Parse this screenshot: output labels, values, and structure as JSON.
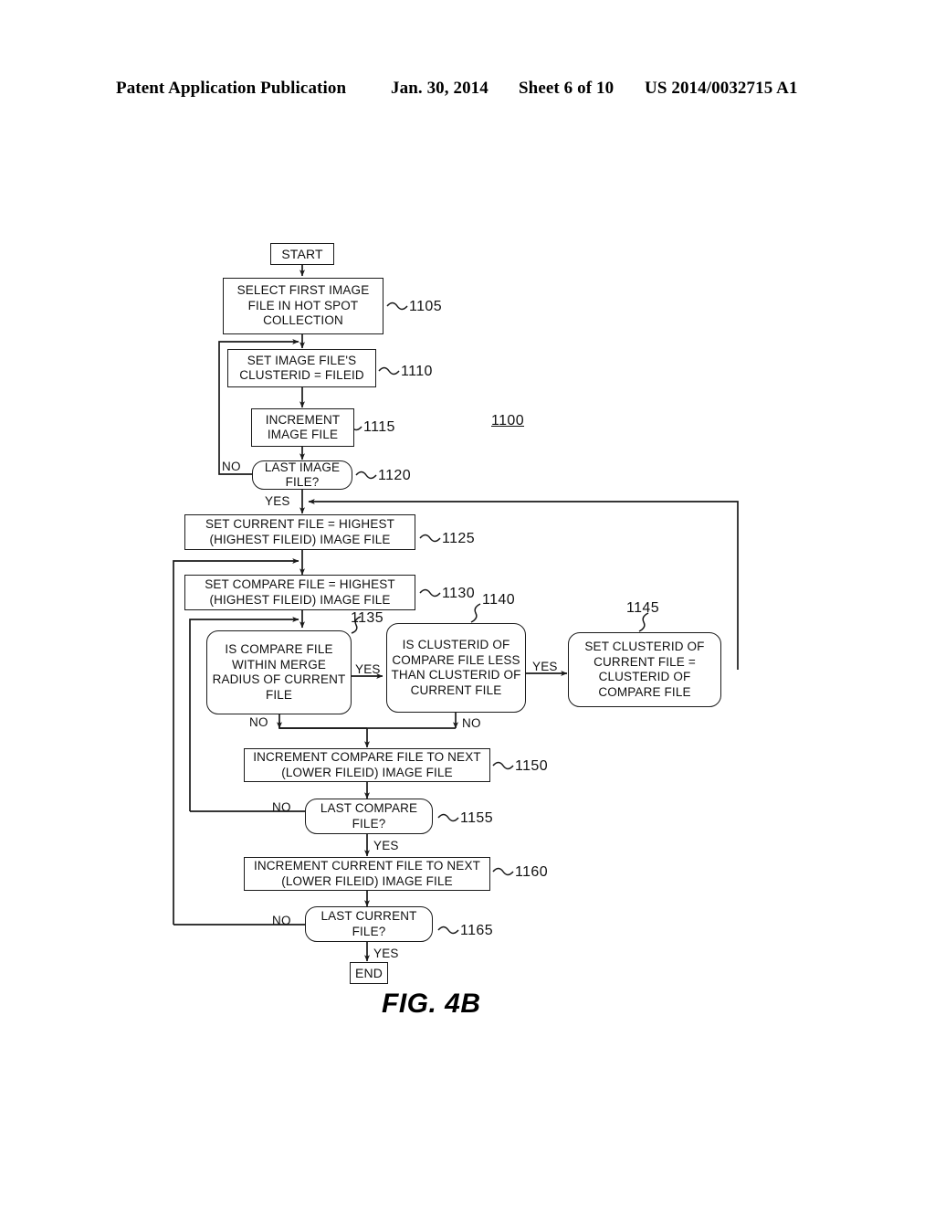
{
  "header": {
    "publication": "Patent Application Publication",
    "date": "Jan. 30, 2014",
    "sheet": "Sheet 6 of 10",
    "number": "US 2014/0032715 A1"
  },
  "figure": {
    "caption": "FIG. 4B",
    "diagram_ref": "1100"
  },
  "nodes": {
    "start": {
      "label": "START",
      "ref": ""
    },
    "select_first": {
      "label": "SELECT FIRST IMAGE FILE IN HOT SPOT COLLECTION",
      "ref": "1105"
    },
    "set_clusterid": {
      "label": "SET IMAGE FILE'S CLUSTERID = FILEID",
      "ref": "1110"
    },
    "increment_image": {
      "label": "INCREMENT IMAGE FILE",
      "ref": "1115"
    },
    "last_image": {
      "label": "LAST IMAGE FILE?",
      "ref": "1120"
    },
    "set_current": {
      "label": "SET CURRENT FILE = HIGHEST (HIGHEST FILEID) IMAGE FILE",
      "ref": "1125"
    },
    "set_compare": {
      "label": "SET COMPARE FILE = HIGHEST (HIGHEST FILEID) IMAGE FILE",
      "ref": "1130"
    },
    "within_radius": {
      "label": "IS COMPARE FILE WITHIN MERGE RADIUS OF CURRENT FILE",
      "ref": "1135"
    },
    "clusterid_less": {
      "label": "IS CLUSTERID OF COMPARE FILE LESS THAN CLUSTERID OF CURRENT FILE",
      "ref": "1140"
    },
    "set_cluster_merge": {
      "label": "SET CLUSTERID OF CURRENT FILE = CLUSTERID OF COMPARE FILE",
      "ref": "1145"
    },
    "increment_compare": {
      "label": "INCREMENT COMPARE FILE TO NEXT (LOWER FILEID) IMAGE FILE",
      "ref": "1150"
    },
    "last_compare": {
      "label": "LAST COMPARE FILE?",
      "ref": "1155"
    },
    "increment_current": {
      "label": "INCREMENT CURRENT FILE TO NEXT (LOWER FILEID) IMAGE FILE",
      "ref": "1160"
    },
    "last_current": {
      "label": "LAST CURRENT FILE?",
      "ref": "1165"
    },
    "end": {
      "label": "END",
      "ref": ""
    }
  },
  "edges": {
    "last_image_no": "NO",
    "last_image_yes": "YES",
    "within_radius_yes": "YES",
    "within_radius_no": "NO",
    "clusterid_less_yes": "YES",
    "clusterid_less_no": "NO",
    "last_compare_no": "NO",
    "last_compare_yes": "YES",
    "last_current_no": "NO",
    "last_current_yes": "YES"
  }
}
